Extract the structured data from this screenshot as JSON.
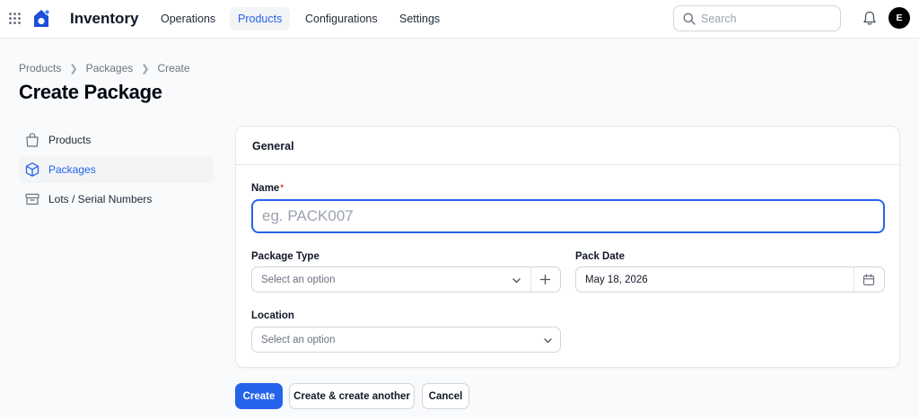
{
  "topbar": {
    "app_title": "Inventory",
    "nav": [
      {
        "label": "Operations"
      },
      {
        "label": "Products",
        "active": true
      },
      {
        "label": "Configurations"
      },
      {
        "label": "Settings"
      }
    ],
    "search_placeholder": "Search",
    "avatar_initial": "E",
    "accent_color": "#2563eb"
  },
  "breadcrumb": [
    "Products",
    "Packages",
    "Create"
  ],
  "page_title": "Create Package",
  "sidebar": {
    "items": [
      {
        "label": "Products",
        "icon": "shopping-bag-icon"
      },
      {
        "label": "Packages",
        "icon": "cube-icon",
        "active": true
      },
      {
        "label": "Lots / Serial Numbers",
        "icon": "archive-box-icon"
      }
    ]
  },
  "form": {
    "section_title": "General",
    "name": {
      "label": "Name",
      "required_mark": "*",
      "placeholder": "eg. PACK007",
      "value": ""
    },
    "package_type": {
      "label": "Package Type",
      "placeholder": "Select an option"
    },
    "pack_date": {
      "label": "Pack Date",
      "value": "May 18, 2026"
    },
    "location": {
      "label": "Location",
      "placeholder": "Select an option"
    }
  },
  "actions": {
    "create": "Create",
    "create_another": "Create & create another",
    "cancel": "Cancel"
  }
}
